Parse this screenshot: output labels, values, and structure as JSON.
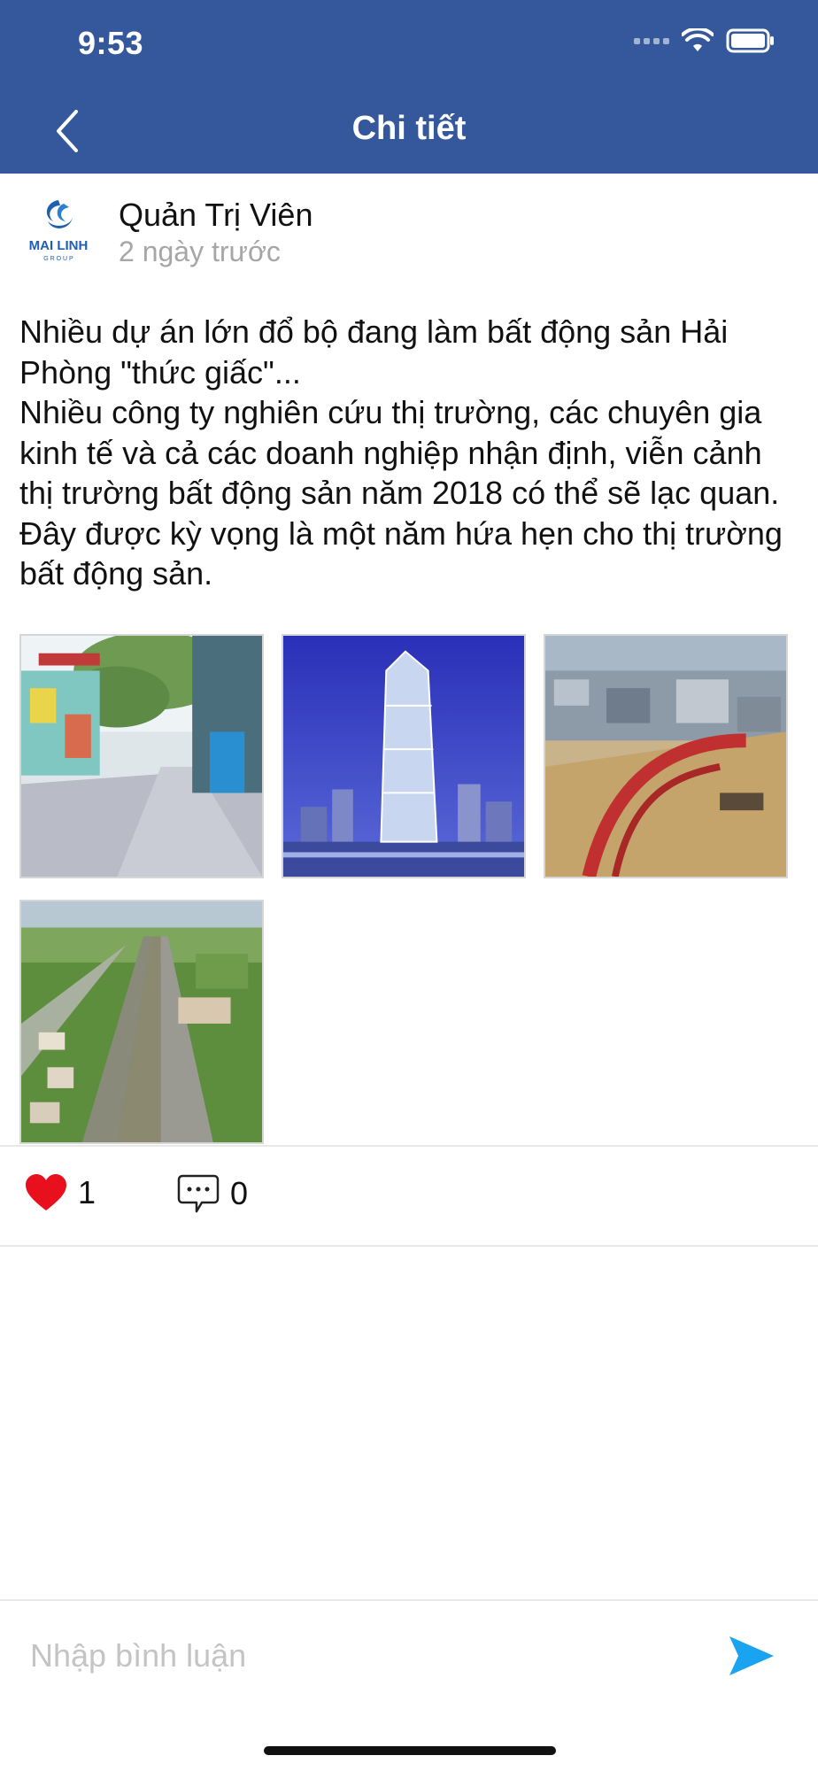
{
  "status_bar": {
    "time": "9:53"
  },
  "nav": {
    "title": "Chi tiết",
    "back_icon": "chevron-left-icon"
  },
  "author": {
    "name": "Quản Trị Viên",
    "time_ago": "2 ngày trước",
    "logo_text": "MAI LINH",
    "logo_subtext": "G R O U P"
  },
  "post": {
    "paragraphs": [
      "Nhiều dự án lớn đổ bộ đang làm bất động sản Hải Phòng \"thức giấc\"...",
      "Nhiều công ty nghiên cứu thị trường, các chuyên gia kinh tế và cả các doanh nghiệp nhận định, viễn cảnh thị trường bất động sản năm 2018 có thể sẽ lạc quan. Đây được kỳ vọng là một năm hứa hẹn cho thị trường bất động sản."
    ],
    "images": [
      "street-photo",
      "tower-photo",
      "river-bridge-photo",
      "canal-road-photo"
    ]
  },
  "actions": {
    "likes": "1",
    "comments": "0",
    "like_icon": "heart-icon",
    "comment_icon": "comment-bubble-icon"
  },
  "comment_input": {
    "placeholder": "Nhập bình luận",
    "send_icon": "send-icon"
  },
  "colors": {
    "header": "#35589c",
    "like": "#e8101c",
    "send": "#1aa3f0"
  }
}
